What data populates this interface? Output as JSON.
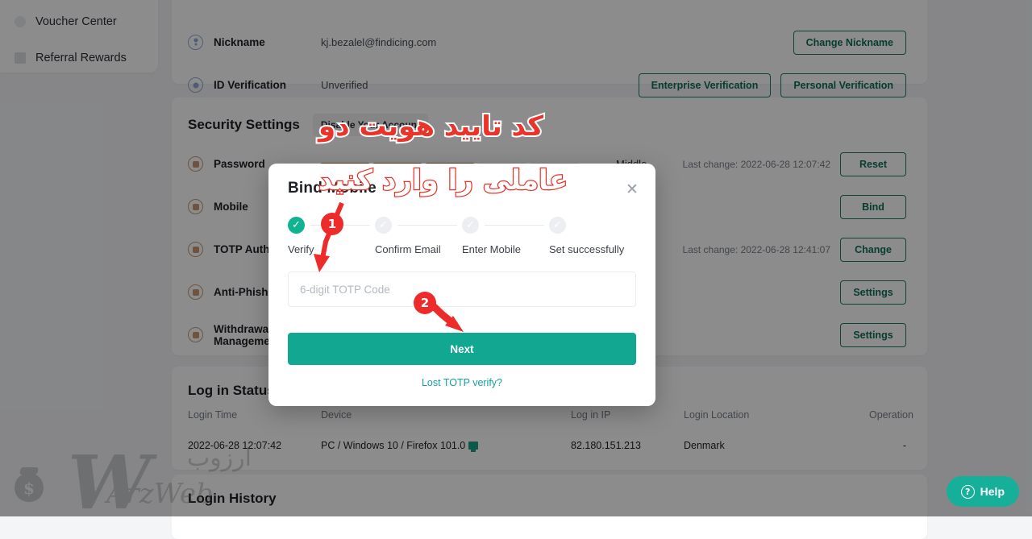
{
  "sidebar": {
    "items": [
      {
        "label": "Voucher Center",
        "icon": "dot-icon"
      },
      {
        "label": "Referral Rewards",
        "icon": "square-icon"
      }
    ]
  },
  "account_card": {
    "rows": [
      {
        "icon": "person-circle-icon",
        "label": "Nickname",
        "value": "kj.bezalel@findicing.com",
        "buttons": [
          "Change Nickname"
        ]
      },
      {
        "icon": "id-circle-icon",
        "label": "ID Verification",
        "value": "Unverified",
        "buttons": [
          "Enterprise Verification",
          "Personal Verification"
        ]
      }
    ]
  },
  "security_card": {
    "title": "Security Settings",
    "disable_account_label": "Disable Your Account",
    "rows": [
      {
        "icon": "lock-icon",
        "label": "Password",
        "strength_label": "Middle",
        "strength_filled": 3,
        "strength_total": 5,
        "note": "Last change:  2022-06-28 12:07:42",
        "button": "Reset"
      },
      {
        "icon": "mobile-icon",
        "label": "Mobile",
        "strength_label": "",
        "note": "",
        "button": "Bind"
      },
      {
        "icon": "totp-icon",
        "label": "TOTP Authenticator",
        "strength_label": "",
        "note": "Last change:  2022-06-28 12:41:07",
        "button": "Change"
      },
      {
        "icon": "shield-icon",
        "label": "Anti-Phishing Code",
        "strength_label": "",
        "note": "",
        "button": "Settings"
      },
      {
        "icon": "withdraw-icon",
        "label": "Withdrawal Management",
        "strength_label": "",
        "note": "",
        "button": "Settings"
      }
    ]
  },
  "login_status": {
    "title": "Log in Status Management",
    "columns": [
      "Login Time",
      "Device",
      "Log in IP",
      "Login Location",
      "Operation"
    ],
    "rows": [
      {
        "time": "2022-06-28  12:07:42",
        "device": "PC / Windows 10 / Firefox 101.0",
        "ip": "82.180.151.213",
        "location": "Denmark",
        "operation": "-"
      }
    ]
  },
  "login_history": {
    "title": "Login History"
  },
  "modal": {
    "title": "Bind Mobile",
    "close_icon": "close-icon",
    "steps": [
      {
        "label": "Verify",
        "state": "done"
      },
      {
        "label": "Confirm Email",
        "state": "pending"
      },
      {
        "label": "Enter Mobile",
        "state": "pending"
      },
      {
        "label": "Set successfully",
        "state": "pending"
      }
    ],
    "input_placeholder": "6-digit TOTP Code",
    "input_value": "",
    "next_label": "Next",
    "lost_link": "Lost TOTP verify?"
  },
  "annotations": {
    "persian_line_1": "کد تایید هویت دو",
    "persian_line_2": "عاملی را وارد کنید",
    "badges": [
      "1",
      "2"
    ]
  },
  "help": {
    "label": "Help",
    "icon": "question-mark-icon"
  },
  "watermark": {
    "persian": "ارزوب",
    "latin": "ArzWeb",
    "mark": "W",
    "bag_symbol": "$"
  },
  "colors": {
    "accent_teal": "#11a791",
    "outline_green": "#1a7f64",
    "annotation_red": "#e8342a",
    "strength_fill": "#9b6a34"
  }
}
